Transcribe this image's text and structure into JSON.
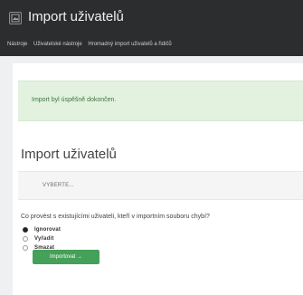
{
  "header": {
    "title": "Import uživatelů",
    "breadcrumb": [
      "Nástroje",
      "Uživatelské nástroje",
      "Hromadný import uživatelů a řidičů"
    ]
  },
  "alert": {
    "message": "Import byl úspěšně dokončen.",
    "color": "#3c763d",
    "background": "#e3f1df"
  },
  "import_section": {
    "title": "Import uživatelů",
    "choose_button_label": "VYBERTE...",
    "question": "Co provést s existujícími uživateli, kteří v importním souboru chybí?",
    "options": [
      {
        "label": "Ignorovat",
        "selected": true
      },
      {
        "label": "Vyřadit",
        "selected": false
      },
      {
        "label": "Smazat",
        "selected": false
      }
    ],
    "submit_label": "Importovat →",
    "submit_color": "#45a05a"
  },
  "icons": {
    "app": "image-icon"
  }
}
